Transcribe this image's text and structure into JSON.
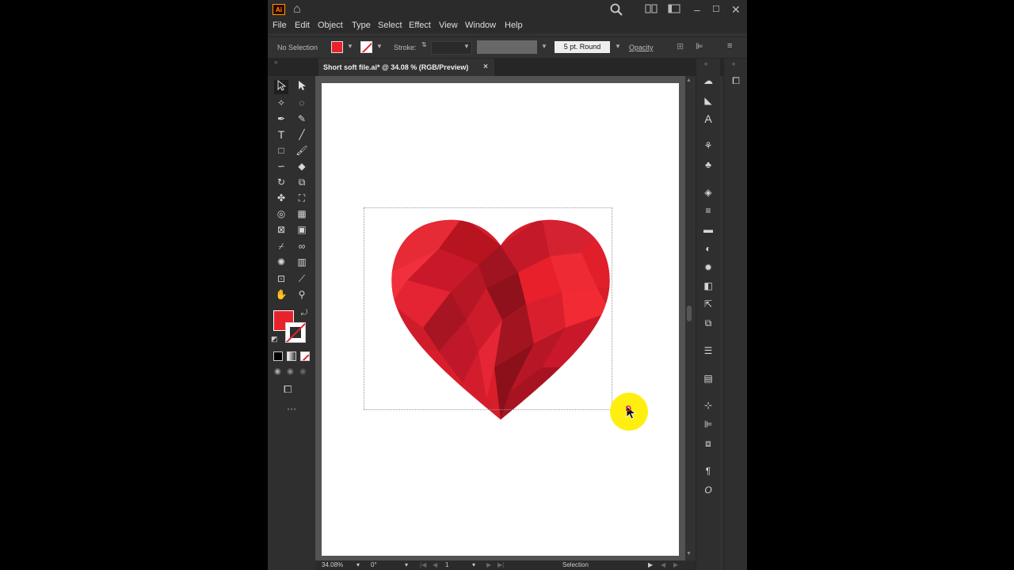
{
  "app": {
    "logo": "Ai",
    "menu": [
      "File",
      "Edit",
      "Object",
      "Type",
      "Select",
      "Effect",
      "View",
      "Window",
      "Help"
    ]
  },
  "control_bar": {
    "selection_label": "No Selection",
    "stroke_label": "Stroke:",
    "brush_label": "5 pt. Round",
    "opacity_label": "Opacity",
    "fill_color": "#e8222b"
  },
  "document": {
    "tab_title": "Short soft file.ai* @ 34.08 % (RGB/Preview)",
    "tab_close": "×"
  },
  "status_bar": {
    "zoom": "34.08%",
    "rotation": "0°",
    "artboard": "1",
    "tool": "Selection"
  },
  "colors": {
    "accent": "#ff9a00",
    "heart_red": "#e8222b",
    "cursor_highlight": "#ffef10"
  }
}
